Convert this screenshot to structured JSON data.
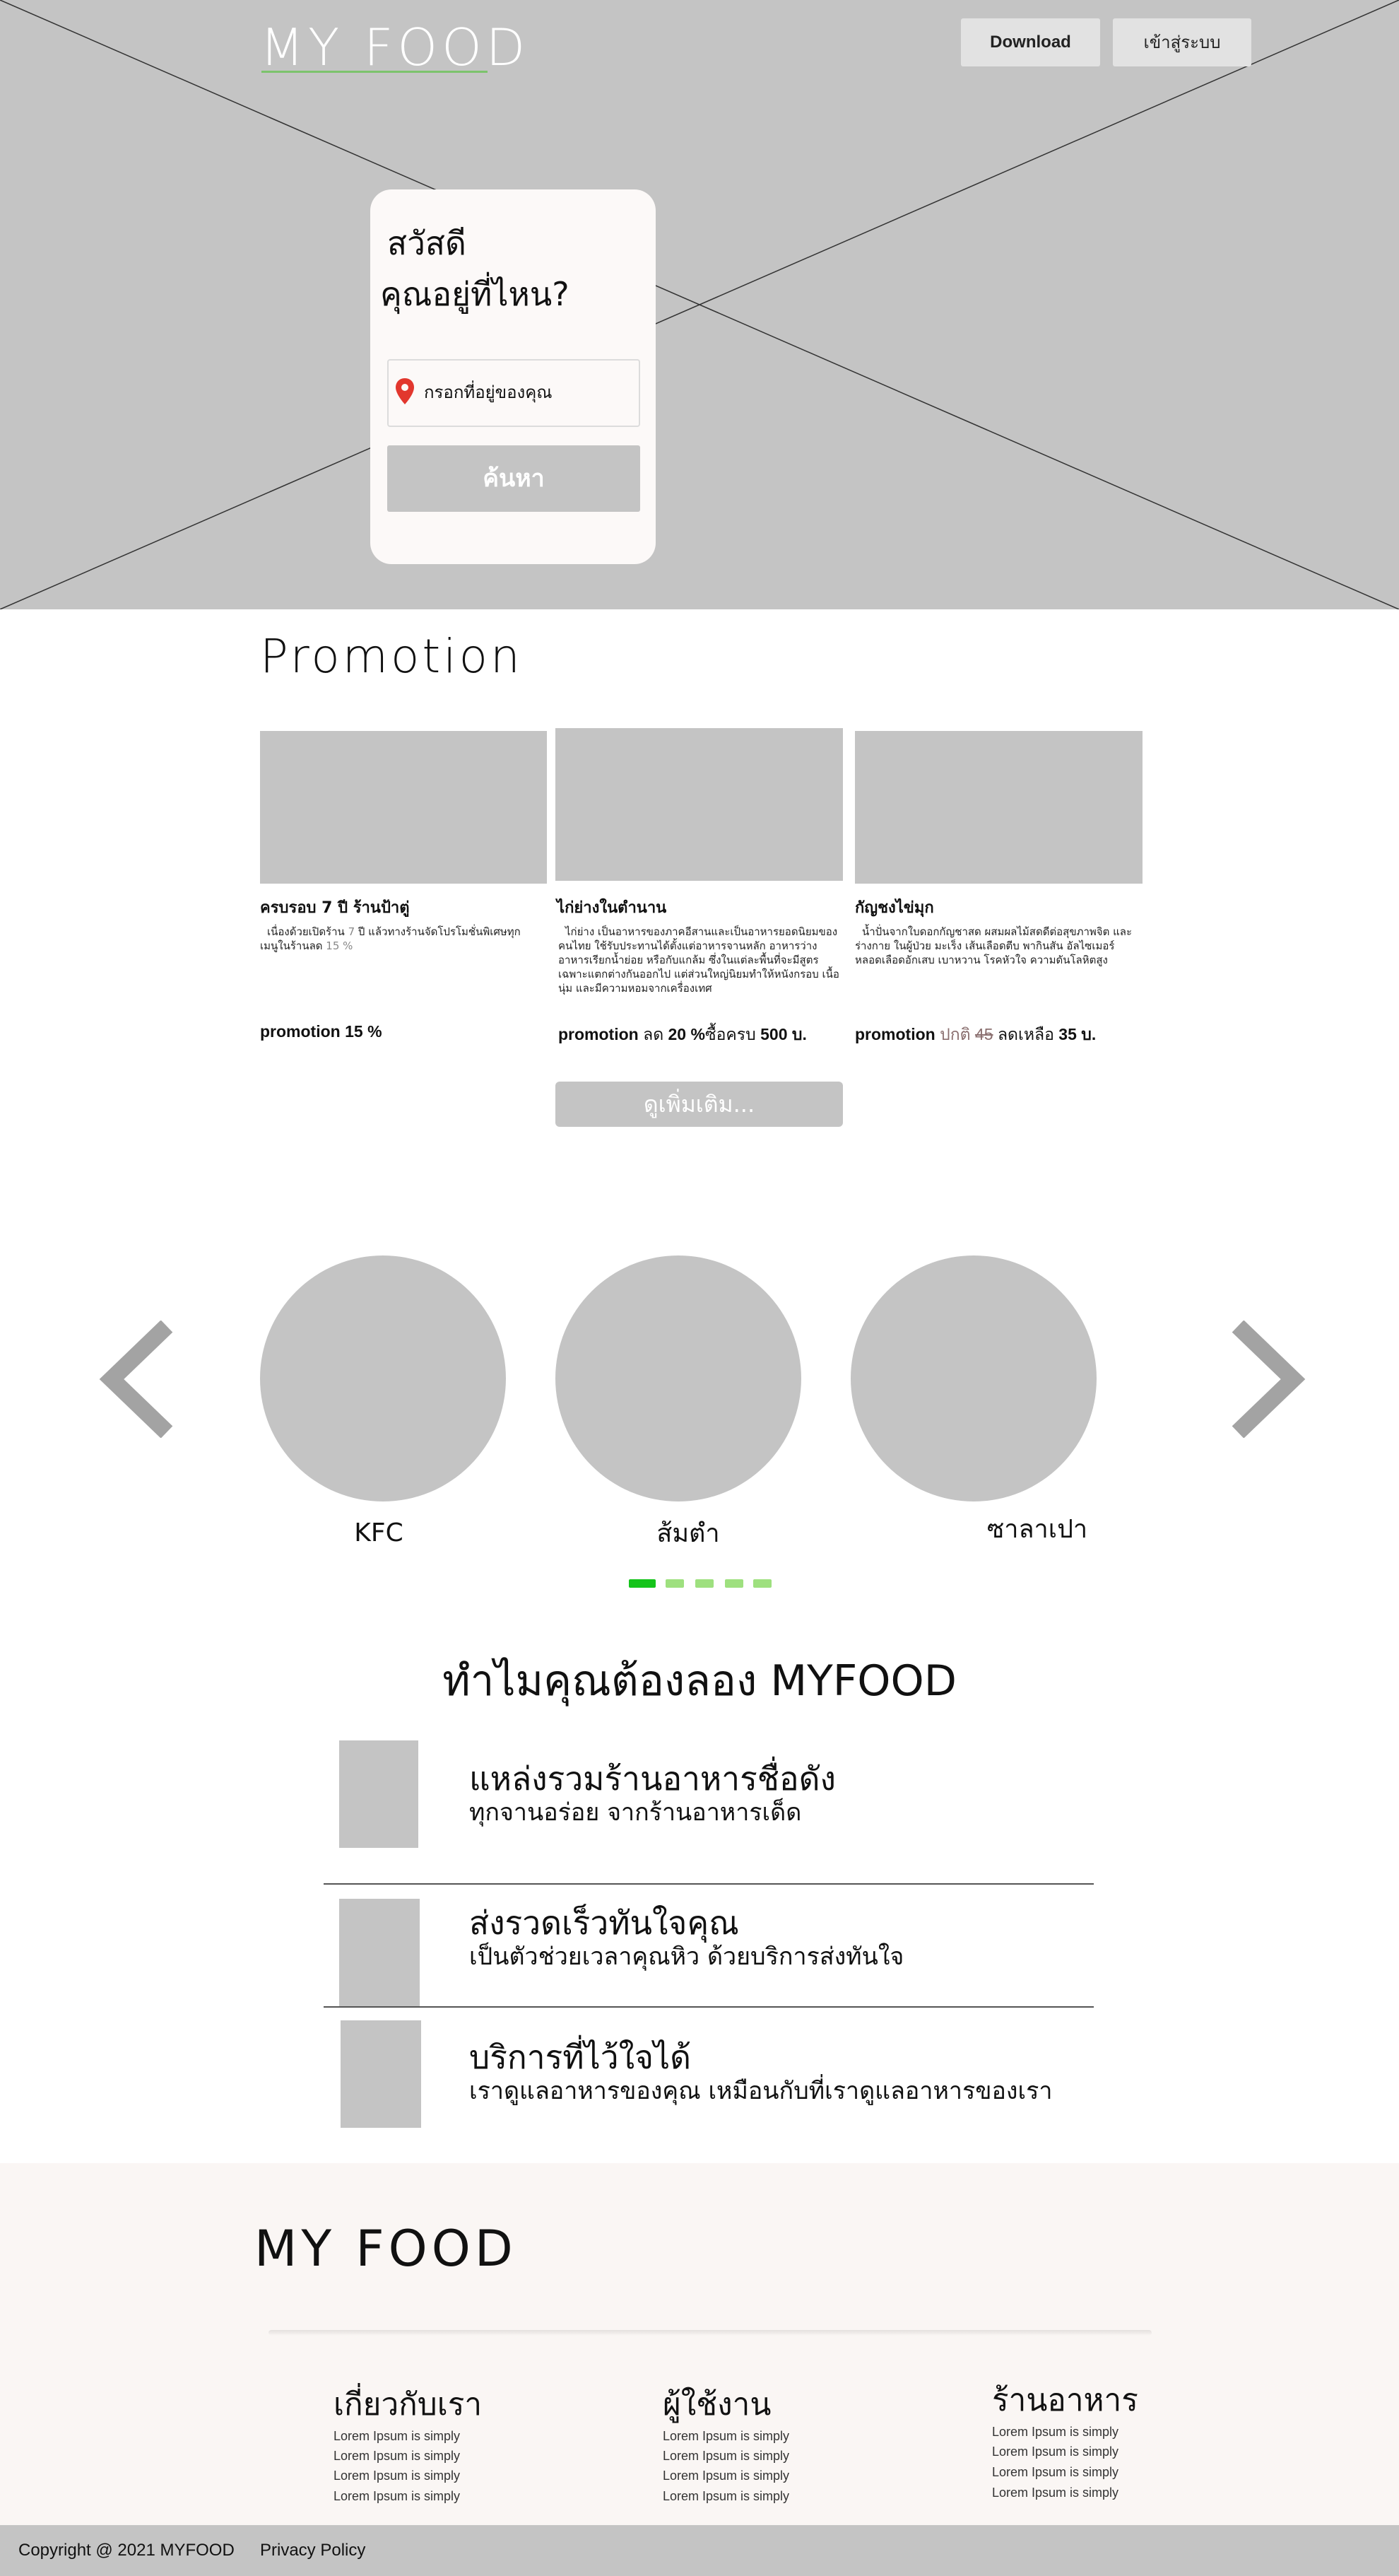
{
  "header": {
    "logo": "MY FOOD",
    "download_label": "Download",
    "login_label": "เข้าสู่ระบบ"
  },
  "search": {
    "greeting": "สวัสดี",
    "question": "คุณอยู่ที่ไหน?",
    "placeholder": "กรอกที่อยู่ของคุณ",
    "button_label": "ค้นหา"
  },
  "promotion": {
    "title": "Promotion",
    "cards": [
      {
        "name": "ครบรอบ 7 ปี ร้านป้าตู่",
        "desc_pre": "เนื่องด้วยเปิดร้าน ",
        "desc_hl1": "7",
        "desc_mid": " ปี แล้วทางร้านจัดโปรโมชั่นพิเศษทุกเมนูในร้านลด ",
        "desc_hl2": "15 %",
        "promo_label": "promotion",
        "promo_value": "15 %"
      },
      {
        "name": "ไก่ย่างในตำนาน",
        "desc": "ไก่ย่าง เป็นอาหารของภาคอีสานและเป็นอาหารยอดนิยมของคนไทย ใช้รับประทานได้ตั้งแต่อาหารจานหลัก อาหารว่าง อาหารเรียกน้ำย่อย หรือกับแกล้ม ซึ่งในแต่ละพื้นที่จะมีสูตรเฉพาะแตกต่างกันออกไป แต่ส่วนใหญ่นิยมทำให้หนังกรอบ เนื้อนุ่ม และมีความหอมจากเครื่องเทศ",
        "promo_label": "promotion",
        "promo_text_1": "ลด",
        "promo_value": "20 %",
        "promo_text_2": "ซื้อครบ",
        "promo_value_2": "500 บ."
      },
      {
        "name": "กัญชงไข่มุก",
        "desc": "น้ำปั่นจากใบดอกกัญชาสด ผสมผลไม้สดดีต่อสุขภาพจิต และร่างกาย ในผู้ป่วย มะเร็ง เส้นเลือดตีบ พากินสัน อัลไซเมอร์ หลอดเลือดอักเสบ เบาหวาน โรคหัวใจ ความดันโลหิตสูง",
        "promo_label": "promotion",
        "promo_normal": "ปกติ",
        "promo_old": "45",
        "promo_text": "ลดเหลือ",
        "promo_value": "35 บ."
      }
    ],
    "more_label": "ดูเพิ่มเติม..."
  },
  "carousel": {
    "items": [
      "KFC",
      "ส้มตำ",
      "ซาลาเปา"
    ],
    "active_index": 0,
    "dot_count": 5,
    "colors": {
      "active": "#15c41b",
      "inactive": "#9ee07f",
      "arrow": "#a3a3a3"
    }
  },
  "why": {
    "title": "ทำไมคุณต้องลอง MYFOOD",
    "items": [
      {
        "heading": "แหล่งรวมร้านอาหารชื่อดัง",
        "sub": "ทุกจานอร่อย จากร้านอาหารเด็ด"
      },
      {
        "heading": "ส่งรวดเร็วทันใจคุณ",
        "sub": "เป็นตัวช่วยเวลาคุณหิว ด้วยบริการส่งทันใจ"
      },
      {
        "heading": "บริการที่ไว้ใจได้",
        "sub": "เราดูแลอาหารของคุณ เหมือนกับที่เราดูแลอาหารของเรา"
      }
    ]
  },
  "footer": {
    "logo": "MY FOOD",
    "columns": [
      {
        "title": "เกี่ยวกับเรา",
        "items": [
          "Lorem Ipsum is simply",
          "Lorem Ipsum is simply",
          "Lorem Ipsum is simply",
          "Lorem Ipsum is simply"
        ]
      },
      {
        "title": "ผู้ใช้งาน",
        "items": [
          "Lorem Ipsum is simply",
          "Lorem Ipsum is simply",
          "Lorem Ipsum is simply",
          "Lorem Ipsum is simply"
        ]
      },
      {
        "title": "ร้านอาหาร",
        "items": [
          "Lorem Ipsum is simply",
          "Lorem Ipsum is simply",
          "Lorem Ipsum is simply",
          "Lorem Ipsum is simply"
        ]
      }
    ],
    "copyright": "Copyright @ 2021 MYFOOD",
    "privacy": "Privacy Policy"
  },
  "icons": {
    "pin": "location-pin-icon",
    "prev": "chevron-left-icon",
    "next": "chevron-right-icon"
  },
  "colors": {
    "placeholder_gray": "#c4c4c4",
    "pin_red": "#e2372e",
    "logo_underline": "#7cc36c",
    "card_bg": "#fcf9f8"
  }
}
